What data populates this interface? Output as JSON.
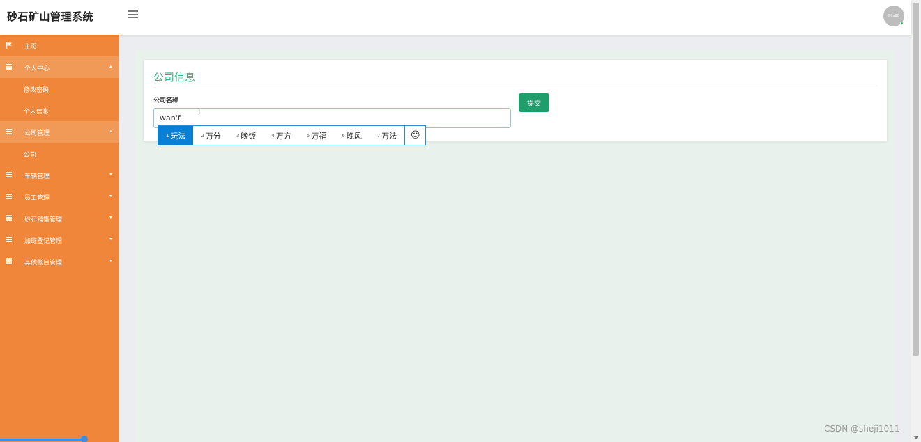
{
  "header": {
    "app_title": "砂石矿山管理系统",
    "avatar_text": "80x80"
  },
  "sidebar": {
    "items": [
      {
        "label": "主页",
        "icon": "flag-icon",
        "type": "top"
      },
      {
        "label": "个人中心",
        "icon": "grid-icon",
        "type": "group",
        "expanded": true
      },
      {
        "label": "修改密码",
        "type": "sub"
      },
      {
        "label": "个人信息",
        "type": "sub"
      },
      {
        "label": "公司管理",
        "icon": "grid-icon",
        "type": "group",
        "expanded": true
      },
      {
        "label": "公司",
        "type": "sub"
      },
      {
        "label": "车辆管理",
        "icon": "grid-icon",
        "type": "group",
        "expanded": false
      },
      {
        "label": "员工管理",
        "icon": "grid-icon",
        "type": "group",
        "expanded": false
      },
      {
        "label": "砂石销售管理",
        "icon": "grid-icon",
        "type": "group",
        "expanded": false
      },
      {
        "label": "加班登记管理",
        "icon": "grid-icon",
        "type": "group",
        "expanded": false
      },
      {
        "label": "其他账目管理",
        "icon": "grid-icon",
        "type": "group",
        "expanded": false
      }
    ]
  },
  "form": {
    "title": "公司信息",
    "company_name_label": "公司名称",
    "company_name_value": "wan'f",
    "submit_label": "提交"
  },
  "ime": {
    "candidates": [
      {
        "num": "1",
        "text": "玩法",
        "active": true
      },
      {
        "num": "2",
        "text": "万分",
        "active": false
      },
      {
        "num": "3",
        "text": "晚饭",
        "active": false
      },
      {
        "num": "4",
        "text": "万方",
        "active": false
      },
      {
        "num": "5",
        "text": "万福",
        "active": false
      },
      {
        "num": "6",
        "text": "晚风",
        "active": false
      },
      {
        "num": "7",
        "text": "万法",
        "active": false
      }
    ],
    "emoji_glyph": "☺"
  },
  "watermark": "CSDN @sheji1011",
  "colors": {
    "sidebar": "#ef863a",
    "accent_green": "#3eaf7c",
    "submit": "#1f9d6b",
    "ime_active": "#0a7fd6"
  }
}
